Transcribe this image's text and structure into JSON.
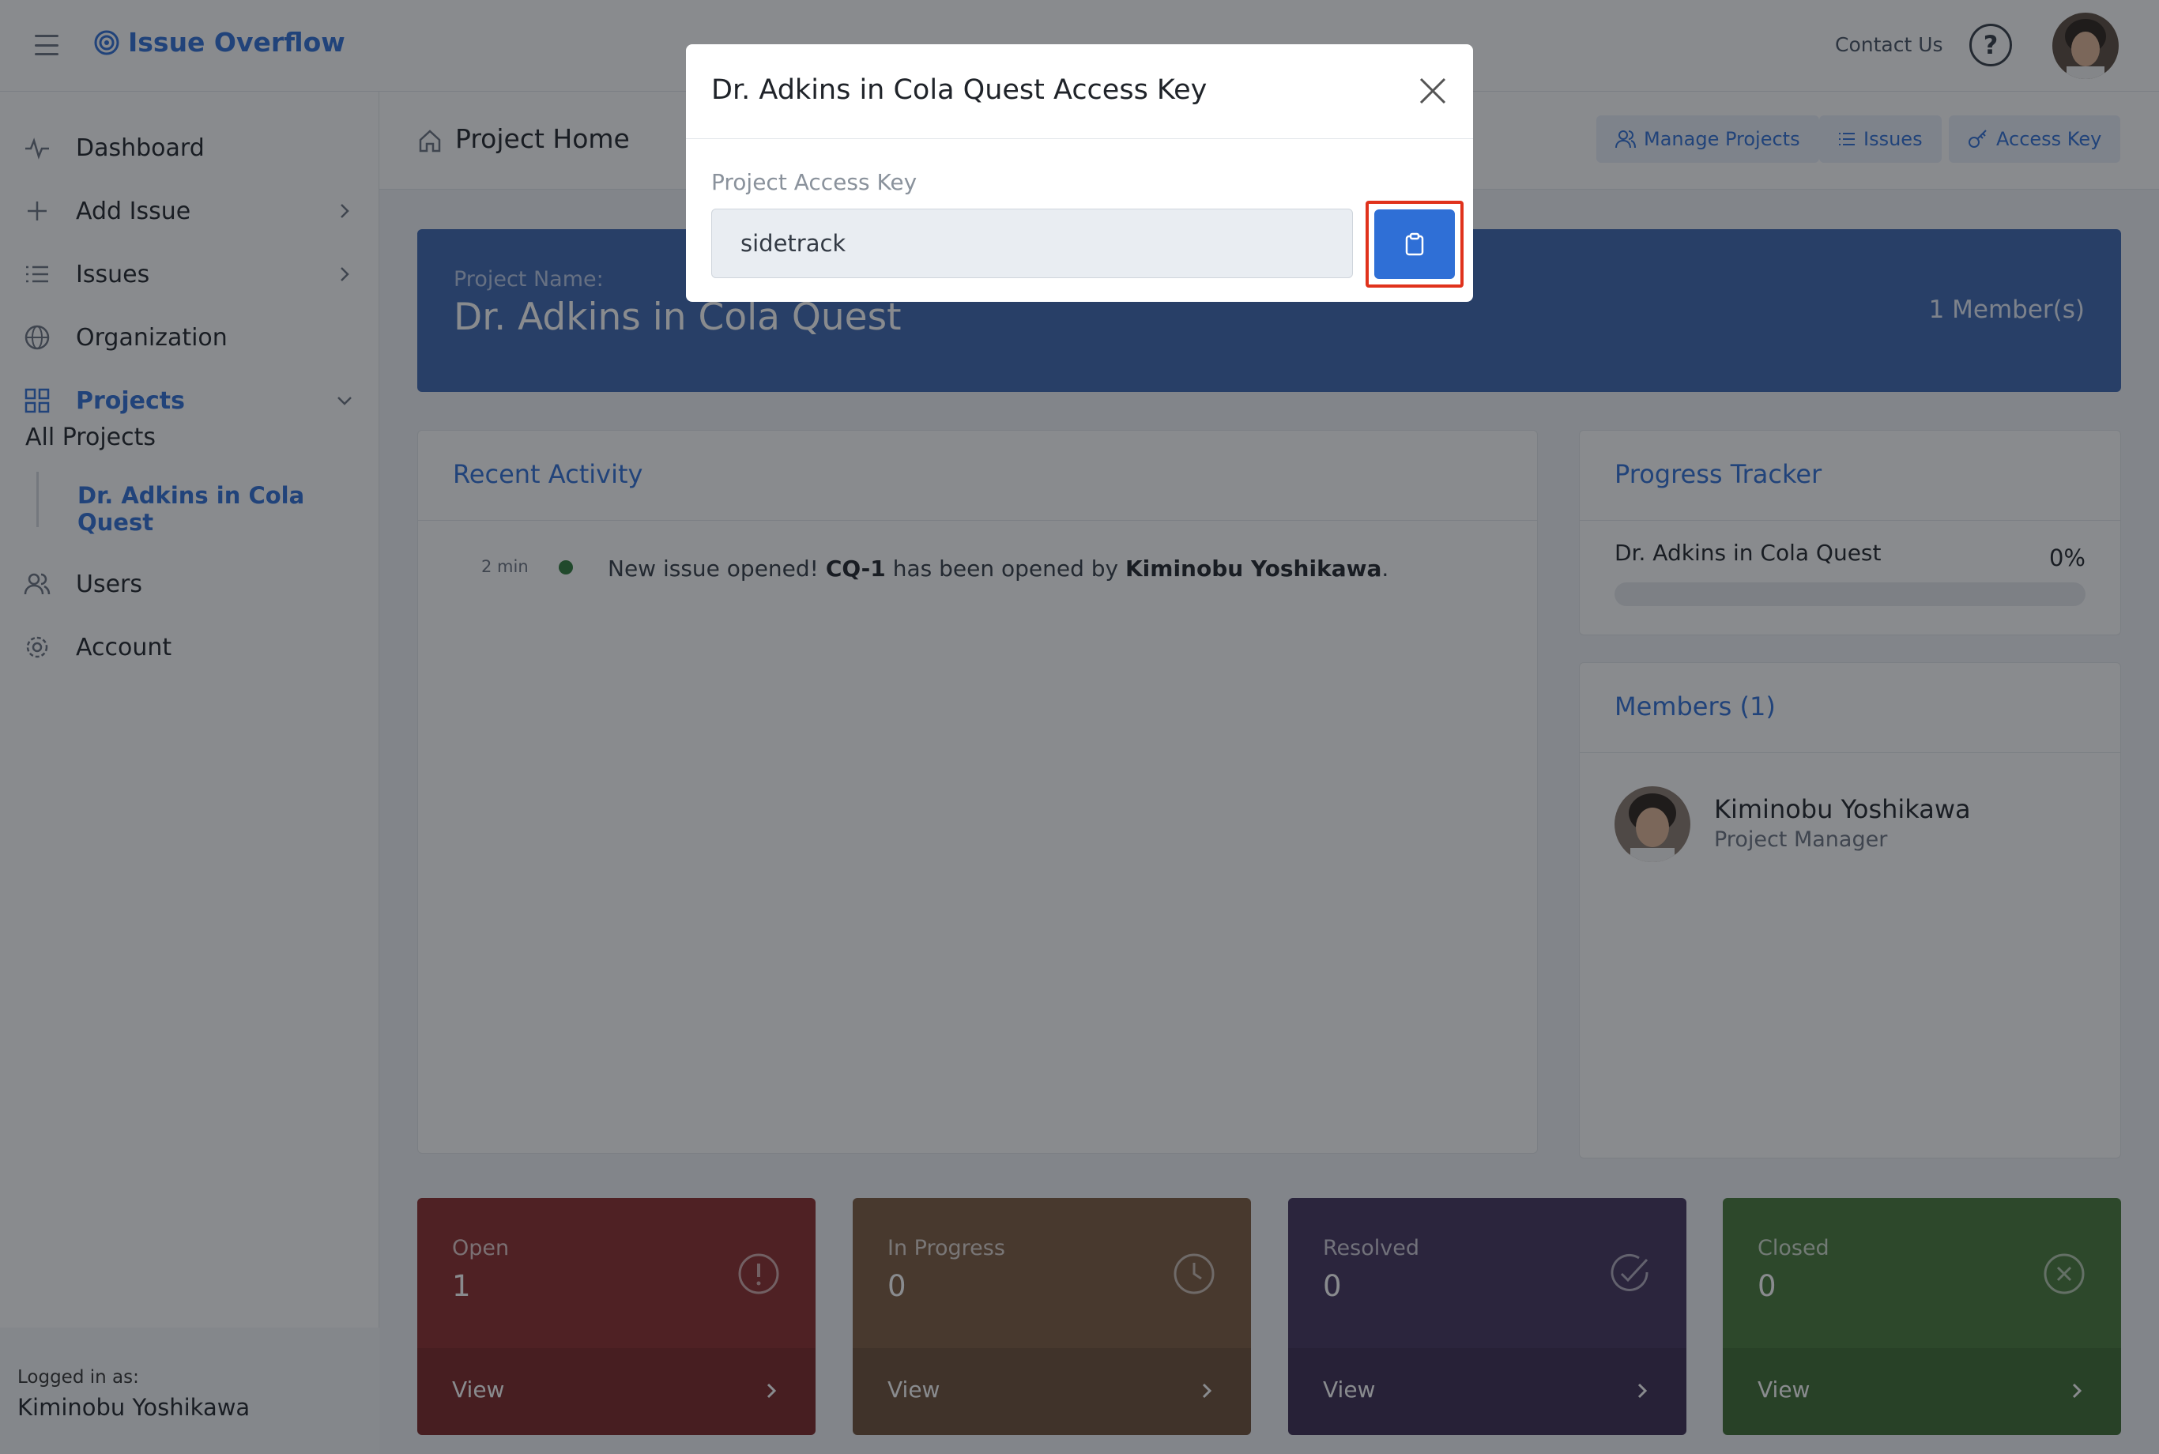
{
  "topbar": {
    "brand": "Issue Overflow",
    "contact": "Contact Us",
    "help": "?"
  },
  "sidebar": {
    "items": [
      {
        "label": "Dashboard"
      },
      {
        "label": "Add Issue"
      },
      {
        "label": "Issues"
      },
      {
        "label": "Organization"
      },
      {
        "label": "Projects"
      },
      {
        "label": "Users"
      },
      {
        "label": "Account"
      }
    ],
    "all_projects": "All Projects",
    "current_project": "Dr. Adkins in Cola Quest",
    "logged_label": "Logged in as:",
    "logged_user": "Kiminobu Yoshikawa"
  },
  "page": {
    "title": "Project Home",
    "buttons": {
      "manage": "Manage Projects",
      "issues": "Issues",
      "access": "Access Key"
    }
  },
  "banner": {
    "project_label": "Project Name:",
    "project_name": "Dr. Adkins in Cola Quest",
    "members": "1 Member(s)"
  },
  "activity": {
    "title": "Recent Activity",
    "time": "2 min",
    "text_pre": "New issue opened! ",
    "issue": "CQ-1",
    "text_mid": " has been opened by ",
    "user": "Kiminobu Yoshikawa",
    "text_post": "."
  },
  "progress": {
    "title": "Progress Tracker",
    "name": "Dr. Adkins in Cola Quest",
    "percent": "0%",
    "value": 0
  },
  "members": {
    "title": "Members (1)",
    "name": "Kiminobu Yoshikawa",
    "role": "Project Manager"
  },
  "tiles": [
    {
      "label": "Open",
      "value": "1",
      "view": "View",
      "color": "#8b2a2a"
    },
    {
      "label": "In Progress",
      "value": "0",
      "view": "View",
      "color": "#7d5a3f"
    },
    {
      "label": "Resolved",
      "value": "0",
      "view": "View",
      "color": "#42325d"
    },
    {
      "label": "Closed",
      "value": "0",
      "view": "View",
      "color": "#467938"
    }
  ],
  "modal": {
    "title": "Dr. Adkins in Cola Quest Access Key",
    "field_label": "Project Access Key",
    "key_value": "sidetrack"
  },
  "colors": {
    "accent": "#2f6fd6",
    "banner": "#3d67b1",
    "highlight": "#e0321c"
  }
}
